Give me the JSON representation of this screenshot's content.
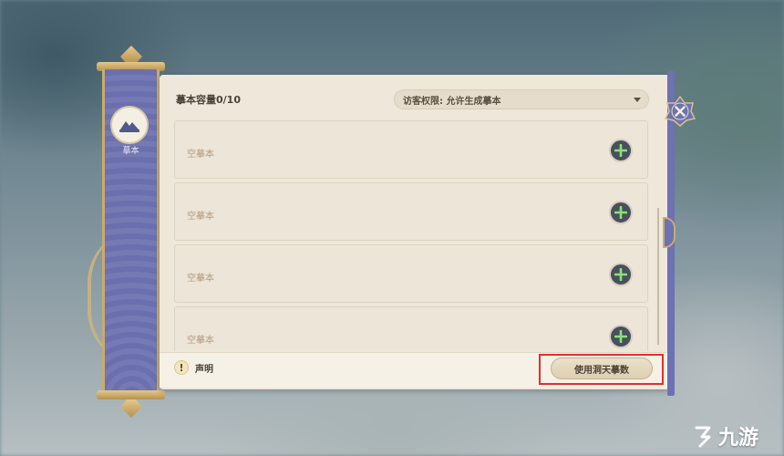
{
  "sidebar": {
    "label": "摹本",
    "icon": "camp-emblem-icon"
  },
  "header": {
    "capacity": "摹本容量0/10",
    "visitor_permission": "访客权限: 允许生成摹本"
  },
  "slots": [
    {
      "label": "空摹本"
    },
    {
      "label": "空摹本"
    },
    {
      "label": "空摹本"
    },
    {
      "label": "空摹本"
    }
  ],
  "footer": {
    "notice_icon_text": "!",
    "notice_label": "声明",
    "use_button": "使用洞天摹数"
  },
  "watermark": {
    "text": "九游"
  },
  "colors": {
    "banner": "#6b6fae",
    "panel": "#eee7da",
    "gold": "#c9ab6e",
    "add_button": "#4a4f5d",
    "add_plus": "#8be07a",
    "highlight": "#e0312c"
  }
}
